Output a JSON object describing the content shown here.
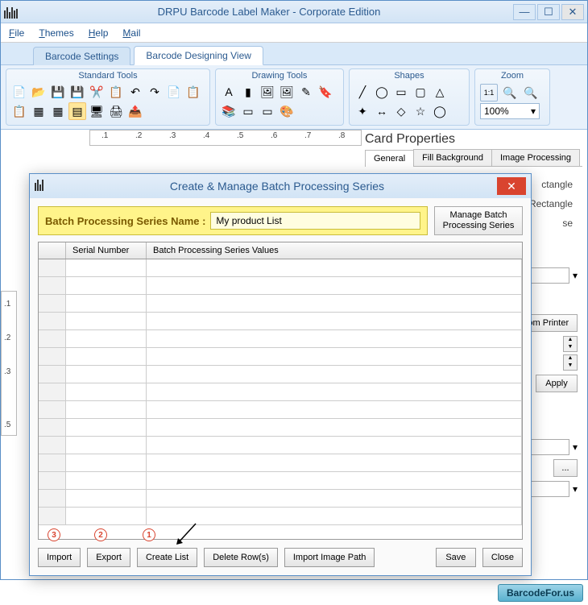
{
  "window": {
    "title": "DRPU Barcode Label Maker - Corporate Edition",
    "menu": [
      "File",
      "Themes",
      "Help",
      "Mail"
    ]
  },
  "tabs": {
    "t1": "Barcode Settings",
    "t2": "Barcode Designing View"
  },
  "ribbon": {
    "g1": "Standard Tools",
    "g2": "Drawing Tools",
    "g3": "Shapes",
    "g4": "Zoom",
    "zoom_value": "100%"
  },
  "ruler": {
    "n1": ".1",
    "n2": ".2",
    "n3": ".3",
    "n4": ".4",
    "n5": ".5",
    "n6": ".6",
    "n7": ".7",
    "n8": ".8"
  },
  "vruler": {
    "v1": ".1",
    "v2": ".2",
    "v3": ".3",
    "v4": ".5"
  },
  "cardprops": {
    "title": "Card Properties",
    "tab1": "General",
    "tab2": "Fill Background",
    "tab3": "Image Processing",
    "shape1": "ctangle",
    "shape2": "und Rectangle",
    "shape3": "se",
    "btn1": "e From Printer",
    "btn2": "Apply",
    "btn3": "..."
  },
  "dialog": {
    "title": "Create & Manage Batch Processing Series",
    "name_label": "Batch Processing Series Name :",
    "name_value": "My product List",
    "manage_btn": "Manage  Batch Processing Series",
    "col1": "Serial Number",
    "col2": "Batch Processing Series Values",
    "buttons": {
      "import": "Import",
      "export": "Export",
      "create": "Create List",
      "delete": "Delete Row(s)",
      "import_img": "Import Image Path",
      "save": "Save",
      "close": "Close"
    },
    "nums": {
      "n1": "1",
      "n2": "2",
      "n3": "3"
    }
  },
  "watermark": "BarcodeFor.us"
}
